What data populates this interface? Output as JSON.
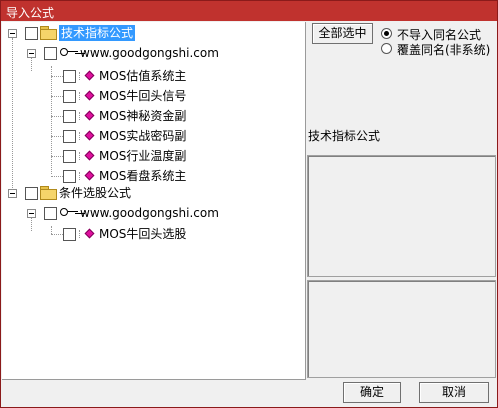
{
  "window": {
    "title": "导入公式"
  },
  "tree": {
    "groups": [
      {
        "label": "技术指标公式",
        "site": "www.goodgongshi.com",
        "items": [
          "MOS估值系统主",
          "MOS牛回头信号",
          "MOS神秘资金副",
          "MOS实战密码副",
          "MOS行业温度副",
          "MOS看盘系统主"
        ]
      },
      {
        "label": "条件选股公式",
        "site": "www.goodgongshi.com",
        "items": [
          "MOS牛回头选股"
        ]
      }
    ]
  },
  "options": {
    "select_all_label": "全部选中",
    "radio_skip_label": "不导入同名公式",
    "radio_overwrite_label": "覆盖同名(非系统)",
    "selected": "skip"
  },
  "info": {
    "type_label": "技术指标公式"
  },
  "footer": {
    "ok_label": "确定",
    "cancel_label": "取消"
  },
  "colors": {
    "titlebar": "#c0322e",
    "selection": "#3399ff",
    "formula_icon": "#e0109e"
  }
}
